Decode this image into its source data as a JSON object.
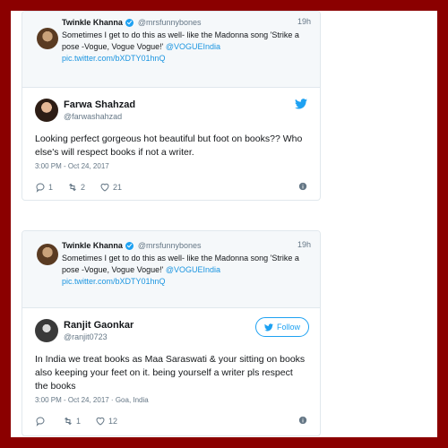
{
  "tweets": [
    {
      "quoted": {
        "name": "Twinkle Khanna",
        "handle": "@mrsfunnybones",
        "time": "19h",
        "text_1": "Sometimes I get to do this as well- like the Madonna song 'Strike a pose -Vogue, Vogue Vogue!' ",
        "mention": "@VOGUEIndia",
        "link": "pic.twitter.com/bXDTY01hnQ"
      },
      "name": "Farwa Shahzad",
      "handle": "@farwashahzad",
      "body": "Looking perfect gorgeous hot beautiful but foot on books?? Who else's will respect books if not a writer.",
      "date": "3:00 PM - Oct 24, 2017",
      "replies": "1",
      "retweets": "2",
      "likes": "21"
    },
    {
      "quoted": {
        "name": "Twinkle Khanna",
        "handle": "@mrsfunnybones",
        "time": "19h",
        "text_1": "Sometimes I get to do this as well- like the Madonna song 'Strike a pose -Vogue, Vogue Vogue!' ",
        "mention": "@VOGUEIndia",
        "link": "pic.twitter.com/bXDTY01hnQ"
      },
      "name": "Ranjit Gaonkar",
      "handle": "@ranjit0723",
      "follow_label": "Follow",
      "body": "In India we treat books as Maa Saraswati & your sitting on books also keeping your feet on it. being yourself a writer pls respect the books",
      "date": "3:00 PM - Oct 24, 2017 · Goa, India",
      "replies": "",
      "retweets": "1",
      "likes": "12"
    }
  ],
  "colors": {
    "frame": "#8b0000",
    "twitter_blue": "#1da1f2",
    "link": "#1b95e0",
    "muted": "#657786"
  }
}
